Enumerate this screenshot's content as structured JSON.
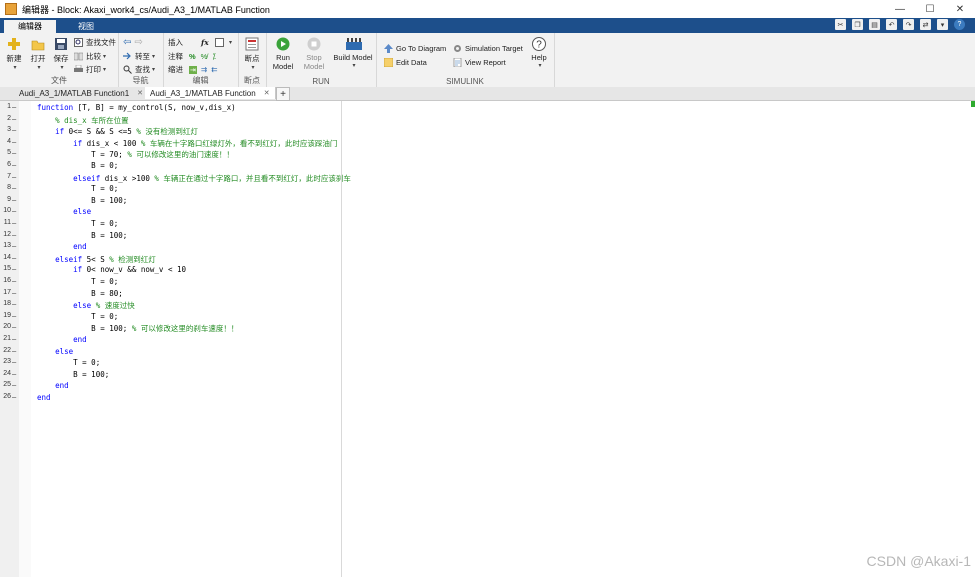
{
  "window": {
    "title": "编辑器 - Block: Akaxi_work4_cs/Audi_A3_1/MATLAB Function",
    "buttons": [
      "—",
      "☐",
      "✕"
    ]
  },
  "ribbon_tabs": [
    {
      "label": "编辑器",
      "active": true
    },
    {
      "label": "视图",
      "active": false
    }
  ],
  "ribbon": {
    "file": {
      "label": "文件",
      "new": "新建",
      "open": "打开",
      "save": "保存",
      "find_files": "查找文件",
      "compare": "比较",
      "print": "打印"
    },
    "navigate": {
      "label": "导航",
      "goto": "转至",
      "find": "查找"
    },
    "edit": {
      "label": "编辑",
      "insert": "插入",
      "comment": "注释",
      "indent": "缩进",
      "fx": "fx"
    },
    "breakpoints": {
      "label": "断点",
      "bp": "断点"
    },
    "run": {
      "label": "RUN",
      "run_model": "Run\nModel",
      "stop_model": "Stop\nModel",
      "build_model": "Build Model"
    },
    "simulink": {
      "label": "SIMULINK",
      "goto_diagram": "Go To Diagram",
      "sim_target": "Simulation Target",
      "edit_data": "Edit Data",
      "view_report": "View Report",
      "help": "Help"
    }
  },
  "doc_tabs": [
    {
      "label": "Audi_A3_1/MATLAB Function1",
      "active": false
    },
    {
      "label": "Audi_A3_1/MATLAB Function",
      "active": true
    }
  ],
  "code": [
    [
      [
        "kw",
        "function"
      ],
      [
        "t",
        " [T, B] = my_control(S, now_v,dis_x)"
      ]
    ],
    [
      [
        "t",
        "    "
      ],
      [
        "cm",
        "% dis_x 车所在位置"
      ]
    ],
    [
      [
        "t",
        "    "
      ],
      [
        "kw",
        "if"
      ],
      [
        "t",
        " 0<= S && S <=5 "
      ],
      [
        "cm",
        "% 没有检测到红灯"
      ]
    ],
    [
      [
        "t",
        "        "
      ],
      [
        "kw",
        "if"
      ],
      [
        "t",
        " dis_x < 100 "
      ],
      [
        "cm",
        "% 车辆在十字路口红绿灯外，看不到红灯，此时应该踩油门"
      ]
    ],
    [
      [
        "t",
        "            T = 70; "
      ],
      [
        "cm",
        "% 可以修改这里的油门速度！！"
      ]
    ],
    [
      [
        "t",
        "            B = 0;"
      ]
    ],
    [
      [
        "t",
        "        "
      ],
      [
        "kw",
        "elseif"
      ],
      [
        "t",
        " dis_x >100 "
      ],
      [
        "cm",
        "% 车辆正在通过十字路口，并且看不到红灯，此时应该刹车"
      ]
    ],
    [
      [
        "t",
        "            T = 0;"
      ]
    ],
    [
      [
        "t",
        "            B = 100;"
      ]
    ],
    [
      [
        "t",
        "        "
      ],
      [
        "kw",
        "else"
      ]
    ],
    [
      [
        "t",
        "            T = 0;"
      ]
    ],
    [
      [
        "t",
        "            B = 100;"
      ]
    ],
    [
      [
        "t",
        "        "
      ],
      [
        "kw",
        "end"
      ]
    ],
    [
      [
        "t",
        "    "
      ],
      [
        "kw",
        "elseif"
      ],
      [
        "t",
        " 5< S "
      ],
      [
        "cm",
        "% 检测到红灯"
      ]
    ],
    [
      [
        "t",
        "        "
      ],
      [
        "kw",
        "if"
      ],
      [
        "t",
        " 0< now_v && now_v < 10"
      ]
    ],
    [
      [
        "t",
        "            T = 0;"
      ]
    ],
    [
      [
        "t",
        "            B = 80;"
      ]
    ],
    [
      [
        "t",
        "        "
      ],
      [
        "kw",
        "else"
      ],
      [
        "t",
        " "
      ],
      [
        "cm",
        "% 速度过快"
      ]
    ],
    [
      [
        "t",
        "            T = 0;"
      ]
    ],
    [
      [
        "t",
        "            B = 100; "
      ],
      [
        "cm",
        "% 可以修改这里的刹车速度！！"
      ]
    ],
    [
      [
        "t",
        "        "
      ],
      [
        "kw",
        "end"
      ]
    ],
    [
      [
        "t",
        "    "
      ],
      [
        "kw",
        "else"
      ]
    ],
    [
      [
        "t",
        "        T = 0;"
      ]
    ],
    [
      [
        "t",
        "        B = 100;"
      ]
    ],
    [
      [
        "t",
        "    "
      ],
      [
        "kw",
        "end"
      ]
    ],
    [
      [
        "kw",
        "end"
      ]
    ]
  ],
  "watermark": "CSDN @Akaxi-1",
  "colors": {
    "accent": "#1d4f8b",
    "keyword": "#0000ff",
    "comment": "#228b22"
  }
}
